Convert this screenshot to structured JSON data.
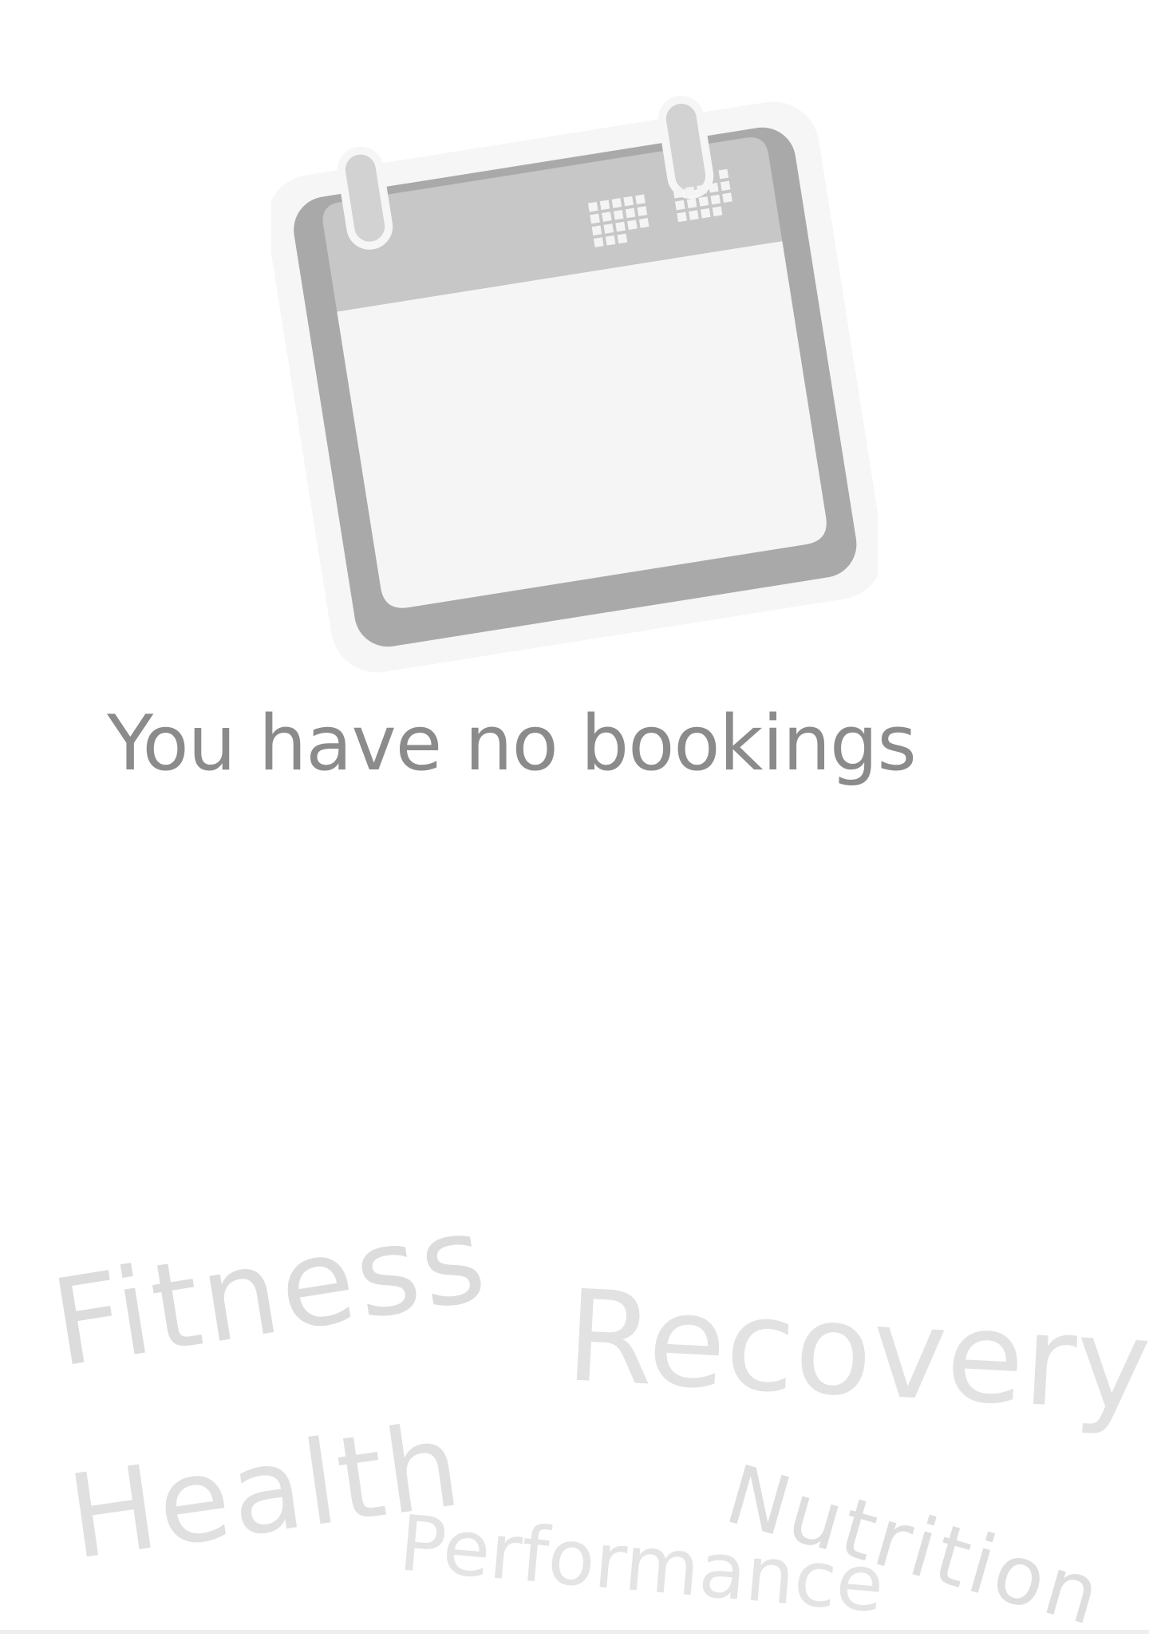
{
  "empty_state": {
    "icon": "calendar-icon",
    "message": "You have no bookings"
  },
  "tags": {
    "fitness": "Fitness",
    "recovery": "Recovery",
    "health": "Health",
    "performance": "Performance",
    "nutrition": "Nutrition"
  },
  "colors": {
    "message_text": "#8b8b8b",
    "tag_text": "#dddddd",
    "calendar_frame": "#a9a9a9",
    "calendar_header": "#c7c7c7",
    "calendar_page": "#f5f5f5"
  }
}
